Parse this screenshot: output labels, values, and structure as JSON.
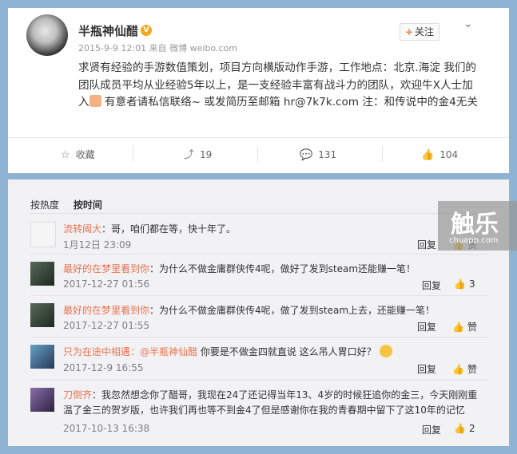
{
  "post": {
    "username": "半瓶神仙醋",
    "verified_badge": "V",
    "meta": "2015-9-9 12:01 来自 微博 weibo.com",
    "follow_label": "关注",
    "content_before_icon": "求贤有经验的手游数值策划，项目方向横版动作手游，工作地点：北京.海淀 我们的团队成员平均从业经验5年以上，是一支经验丰富有战斗力的团队，欢迎牛X人士加入",
    "content_after_icon": " 有意者请私信联络~ 或发简历至邮箱 hr@7k7k.com 注：和传说中的金4无关",
    "actions": [
      {
        "icon": "star-icon",
        "label": "收藏"
      },
      {
        "icon": "share-icon",
        "label": "19"
      },
      {
        "icon": "comment-icon",
        "label": "131"
      },
      {
        "icon": "thumbs-up-icon",
        "label": "104"
      }
    ]
  },
  "comment_tabs": [
    "按热度",
    "按时间"
  ],
  "comments": [
    {
      "name": "流转阈大",
      "text": "：哥，咱们都在等，快十年了。",
      "time": "1月12日 23:09",
      "reply": "回复",
      "likes": "赞"
    },
    {
      "name": "最好的在梦里看到你",
      "text": "：为什么不做金庸群侠传4呢，做好了发到steam还能赚一笔！",
      "time": "2017-12-27 01:56",
      "reply": "回复",
      "likes": "3"
    },
    {
      "name": "最好的在梦里看到你",
      "text": "：为什么不做金庸群侠传4呢，做了发到steam上去，还能赚一笔！",
      "time": "2017-12-27 01:55",
      "reply": "回复",
      "likes": "赞"
    },
    {
      "name": "只为在途中相遇",
      "mention": "：@半瓶神仙醋",
      "text": " 你要是不做金四就直说  这么吊人胃口好？",
      "time": "2017-12-9 16:55",
      "reply": "回复",
      "likes": "赞"
    },
    {
      "name": "刀倒齐",
      "text": "：我忽然想念你了醋哥，我现在24了还记得当年13、4岁的时候狂追你的金三，今天刚刚重温了金三的贺岁版，也许我们再也等不到金4了但是感谢你在我的青春期中留下了这10年的记忆",
      "time": "2017-10-13 16:38",
      "reply": "回复",
      "likes": "2"
    }
  ],
  "watermark": {
    "title": "触乐",
    "sub": "chuapp.com"
  },
  "colors": {
    "accent": "#eb7350",
    "frame": "#8fb4d3",
    "badge": "#f2a71d"
  }
}
